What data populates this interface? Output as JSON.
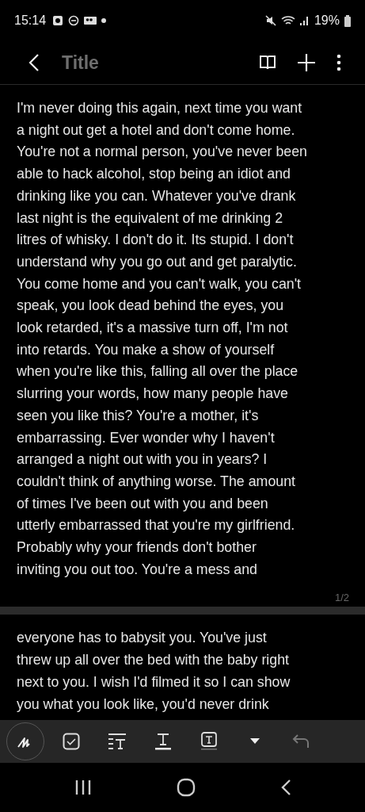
{
  "status_bar": {
    "time": "15:14",
    "battery": "19%"
  },
  "header": {
    "title_placeholder": "Title"
  },
  "pages": [
    {
      "lines": [
        "I'm never doing this again, next time you want",
        "a night out get a hotel and don't come home.",
        "You're not a normal person, you've never been",
        "able to hack alcohol, stop being an idiot and",
        "drinking like you can. Whatever you've drank",
        "last night is the equivalent of me drinking 2",
        "litres of whisky. I don't do it. Its stupid. I don't",
        "understand why you go out and get paralytic.",
        "You come home and you can't walk, you can't",
        "speak, you look dead behind the eyes, you",
        "look retarded, it's a massive turn off, I'm not",
        "into retards. You make a show of yourself",
        "when you're like this, falling all over the place",
        "slurring your words, how many people have",
        "seen you like this? You're a mother, it's",
        "embarrassing. Ever wonder why I haven't",
        "arranged a night out with you in years? I",
        "couldn't think of anything worse. The amount",
        "of times I've been out with you and been",
        "utterly embarrassed that you're my girlfriend.",
        "Probably why your friends don't bother",
        "inviting you out too. You're a mess and"
      ],
      "page_number": "1/2"
    },
    {
      "lines": [
        "everyone has to babysit you. You've just",
        "threw up all over the bed with the baby right",
        "next to you. I wish I'd filmed it so I can show",
        "you what you look like, you'd never drink"
      ]
    }
  ],
  "toolbar": [
    {
      "kind": "pen",
      "selected": true
    },
    {
      "kind": "checkbox",
      "selected": false
    },
    {
      "kind": "text-style",
      "selected": false
    },
    {
      "kind": "text-underline",
      "selected": false
    },
    {
      "kind": "text-box",
      "selected": false
    },
    {
      "kind": "dropdown",
      "selected": false
    },
    {
      "kind": "undo",
      "selected": false
    }
  ]
}
